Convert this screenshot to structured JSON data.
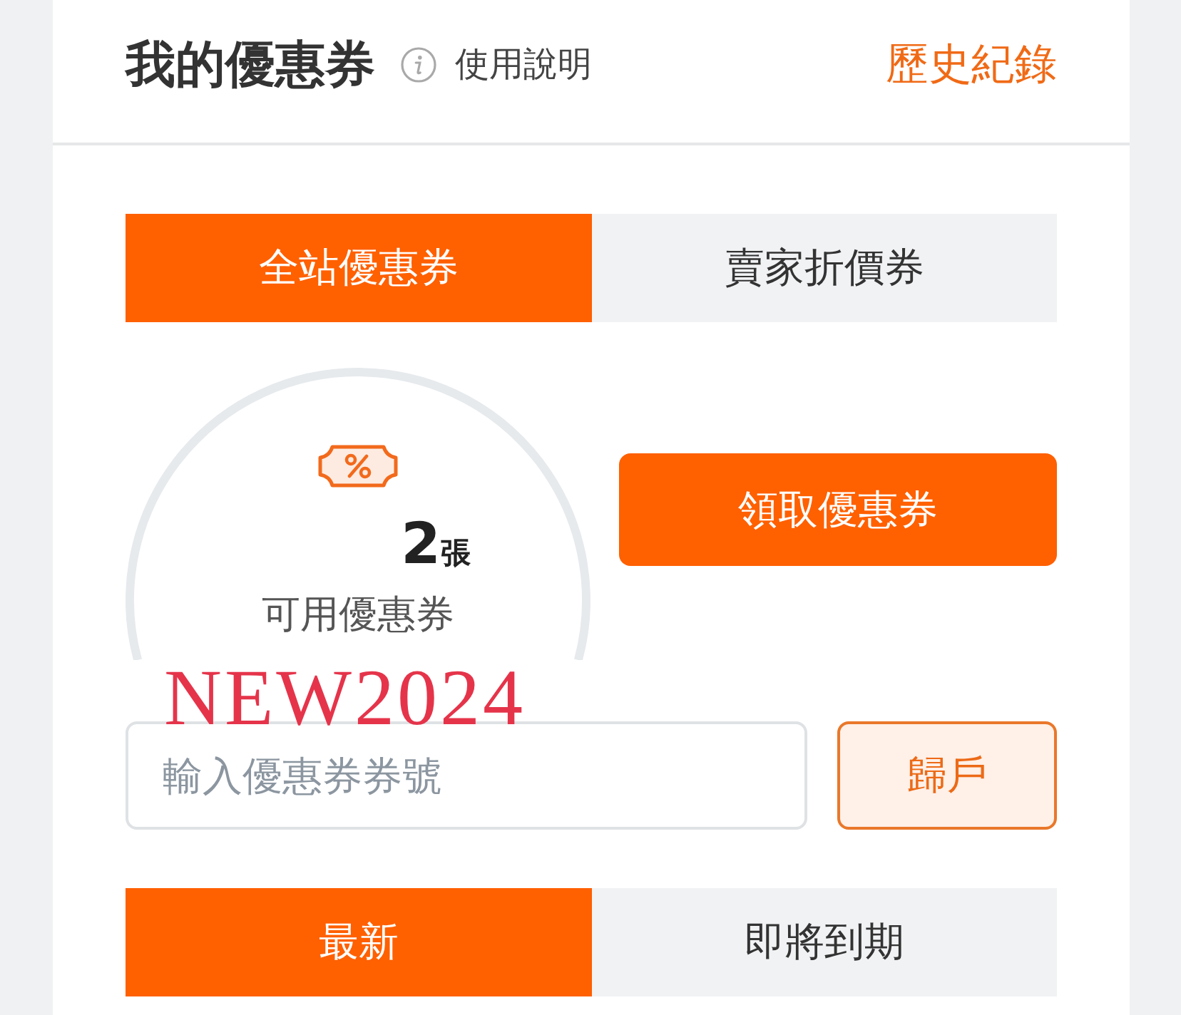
{
  "header": {
    "title": "我的優惠券",
    "help_link": "使用說明",
    "history_link": "歷史紀錄"
  },
  "coupon_tabs": [
    {
      "label": "全站優惠券",
      "selected": true
    },
    {
      "label": "賣家折價券",
      "selected": false
    }
  ],
  "summary": {
    "count": "2",
    "unit": "張",
    "caption": "可用優惠券"
  },
  "claim_button": "領取優惠券",
  "annotation": "NEW2024",
  "code_entry": {
    "placeholder": "輸入優惠券券號",
    "button": "歸戶"
  },
  "sort_tabs": [
    {
      "label": "最新",
      "selected": true
    },
    {
      "label": "即將到期",
      "selected": false
    }
  ]
}
